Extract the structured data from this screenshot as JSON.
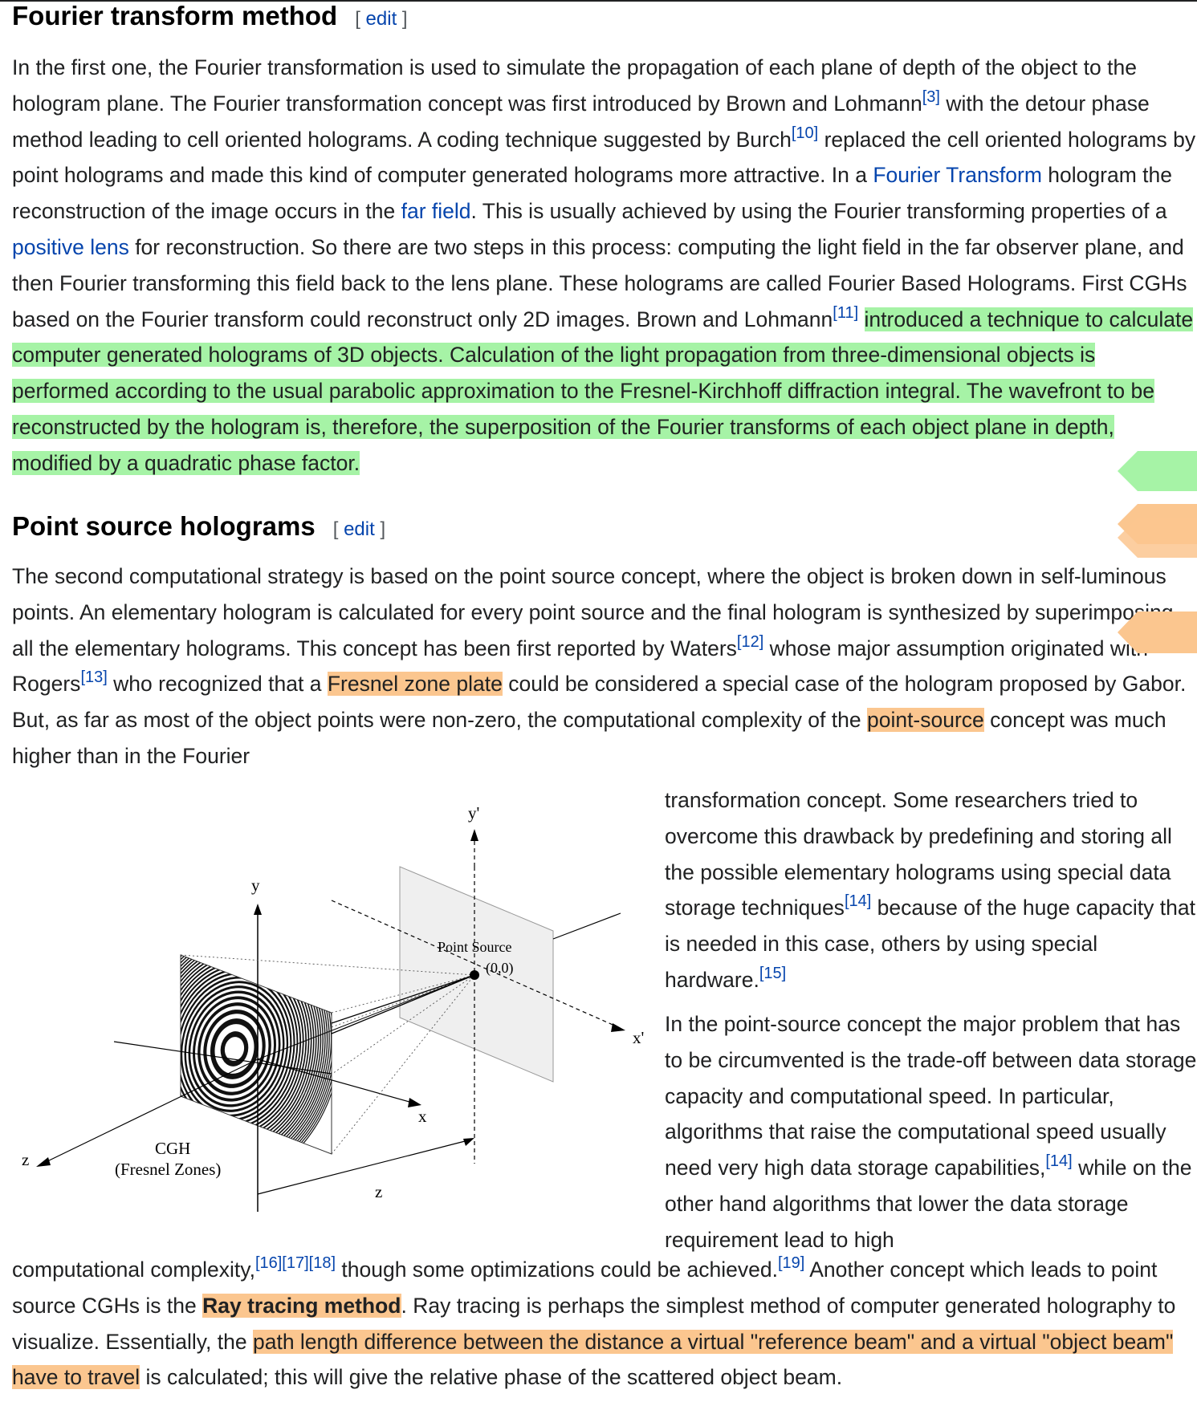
{
  "sections": {
    "fourier": {
      "heading": "Fourier transform method",
      "edit_open": "[ ",
      "edit_label": "edit",
      "edit_close": " ]",
      "t1": "In the first one, the Fourier transformation is used to simulate the propagation of each plane of depth of the object to the hologram plane. The Fourier transformation concept was first introduced by Brown and Lohmann",
      "ref1": "[3]",
      "t2": " with the detour phase method leading to cell oriented holograms. A coding technique suggested by Burch",
      "ref2": "[10]",
      "t3": " replaced the cell oriented holograms by point holograms and made this kind of computer generated holograms more attractive. In a ",
      "link1": "Fourier Transform",
      "t4": " hologram the reconstruction of the image occurs in the ",
      "link2": "far field",
      "t5": ". This is usually achieved by using the Fourier transforming properties of a ",
      "link3": "positive lens",
      "t6": " for reconstruction. So there are two steps in this process: computing the light field in the far observer plane, and then Fourier transforming this field back to the lens plane. These holograms are called Fourier Based Holograms. First CGHs based on the Fourier transform could reconstruct only 2D images. Brown and Lohmann",
      "ref3": "[11]",
      "t7": " ",
      "highlight": "introduced a technique to calculate computer generated holograms of 3D objects. Calculation of the light propagation from three-dimensional objects is performed according to the usual parabolic approximation to the Fresnel-Kirchhoff diffraction integral. The wavefront to be reconstructed by the hologram is, therefore, the superposition of the Fourier transforms of each object plane in depth, modified by a quadratic phase factor."
    },
    "point": {
      "heading": "Point source holograms",
      "edit_open": "[ ",
      "edit_label": "edit",
      "edit_close": " ]",
      "p1_t1": "The second computational strategy is based on the point source concept, where the object is broken down in self-luminous points. An elementary hologram is calculated for every point source and the final hologram is synthesized by superimposing all the elementary holograms. This concept has been first reported by Waters",
      "p1_ref1": "[12]",
      "p1_t2": " whose major assumption originated with Rogers",
      "p1_ref2": "[13]",
      "p1_t3": " who recognized that a ",
      "p1_hl1": "Fresnel zone plate",
      "p1_t4": " could be considered a special case of the hologram proposed by Gabor. But, as far as most of the object points were non-zero, the computational complexity of the ",
      "p1_hl2": "point-source",
      "p1_t5": " concept was much higher than in the Fourier",
      "side1_t1": "transformation concept. Some researchers tried to overcome this drawback by predefining and storing all the possible elementary holograms using special data storage techniques",
      "side1_ref1": "[14]",
      "side1_t2": " because of the huge capacity that is needed in this case, others by using special hardware.",
      "side1_ref2": "[15]",
      "side2_t1": "In the point-source concept the major problem that has to be circumvented is the trade-off between data storage capacity and computational speed. In particular, algorithms that raise the computational speed usually need very high data storage capabilities,",
      "side2_ref1": "[14]",
      "side2_t2": " while on the other hand algorithms that lower the data storage requirement lead to high",
      "bottom_t1": "computational complexity,",
      "bottom_ref1": "[16][17][18]",
      "bottom_t2": " though some optimizations could be achieved.",
      "bottom_ref2": "[19]",
      "bottom_t3": " Another concept which leads to point source CGHs is the ",
      "bottom_hl_bold": "Ray tracing method",
      "bottom_t4": ". Ray tracing is perhaps the simplest method of computer generated holography to visualize. Essentially, the ",
      "bottom_hl2": "path length difference between the distance a virtual \"reference beam\" and a virtual \"object beam\" have to travel",
      "bottom_t5": " is calculated; this will give the relative phase of the scattered object beam."
    }
  },
  "figure": {
    "label_y_prime": "y'",
    "label_y": "y",
    "label_x_prime": "x'",
    "label_x": "x",
    "label_z_axis": "z",
    "label_z_dist": "z",
    "label_point_source": "Point Source",
    "label_origin": "(0,0)",
    "label_cgh": "CGH",
    "label_fresnel": "(Fresnel Zones)"
  },
  "colors": {
    "highlight_green": "#a6f3a6",
    "highlight_orange": "#fbc68f",
    "link": "#0645ad"
  }
}
